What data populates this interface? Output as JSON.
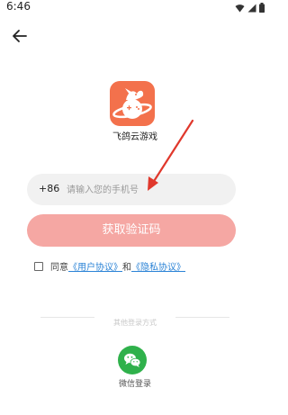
{
  "status_bar": {
    "time": "6:46",
    "icons": [
      "wifi-icon",
      "signal-icon",
      "battery-icon"
    ]
  },
  "header": {
    "back_icon": "arrow-left-icon"
  },
  "app": {
    "name": "飞鸽云游戏",
    "logo_icon": "pigeon-planet-icon",
    "logo_color": "#f3714c"
  },
  "login_form": {
    "country_code": "+86",
    "phone_placeholder": "请输入您的手机号",
    "phone_value": "",
    "get_code_label": "获取验证码",
    "button_color": "#f5a7a3"
  },
  "agreement": {
    "checked": false,
    "prefix": "同意",
    "user_agreement": "《用户协议》",
    "conjunction": "和",
    "privacy_policy": "《隐私协议》",
    "link_color": "#2b83d6"
  },
  "other_login": {
    "title": "其他登录方式",
    "wechat_label": "微信登录",
    "wechat_icon": "wechat-icon",
    "wechat_color": "#2fb14b"
  },
  "annotation": {
    "arrow_color": "#e0382c"
  }
}
